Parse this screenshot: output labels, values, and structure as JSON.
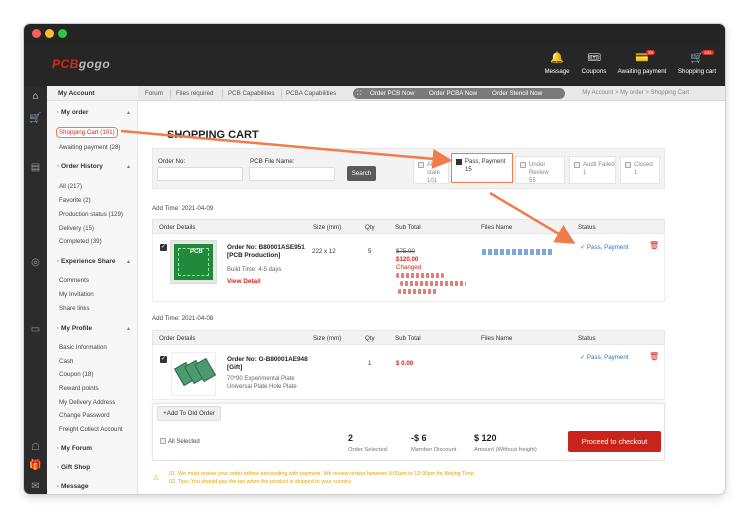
{
  "brand": {
    "logo_text": "PCBgogo"
  },
  "topnav": [
    {
      "label": "Message",
      "icon": "bell-icon"
    },
    {
      "label": "Coupons",
      "icon": "coupon-icon"
    },
    {
      "label": "Awaiting payment",
      "icon": "wallet-icon",
      "badge": "28"
    },
    {
      "label": "Shopping cart",
      "icon": "cart-icon",
      "badge": "101"
    }
  ],
  "sidebar": {
    "header": "My Account",
    "sections": [
      {
        "title": "My order",
        "items": [
          "Shopping Cart (101)",
          "Awaiting payment (28)"
        ]
      },
      {
        "title": "Order History",
        "items": [
          "All (217)",
          "Favorite (2)",
          "Production status (129)",
          "Delivery (15)",
          "Completed (39)"
        ]
      },
      {
        "title": "Experience Share",
        "items": [
          "Comments",
          "My Invitation",
          "Share links"
        ]
      },
      {
        "title": "My Profile",
        "items": [
          "Basic Information",
          "Cash",
          "Coupon (18)",
          "Reward points",
          "My Delivery Address",
          "Change Password",
          "Freight Collect Account"
        ]
      },
      {
        "title": "My Forum",
        "items": []
      },
      {
        "title": "Gift Shop",
        "items": []
      },
      {
        "title": "Message",
        "items": []
      }
    ]
  },
  "crumbbar": {
    "items": [
      "Forum",
      "Files required",
      "PCB Capabilities",
      "PCBA Capabilities"
    ],
    "pill": [
      "Order PCB Now",
      "Order PCBA Now",
      "Order Stencil Now"
    ]
  },
  "breadcrumb": "My Account > My order > Shopping Cart",
  "page_title": "SHOPPING CART",
  "filters": {
    "order_no_label": "Order No:",
    "pcb_file_label": "PCB File Name:",
    "search_label": "Search",
    "statuses": [
      {
        "label": "All state",
        "count": "101",
        "checked": false
      },
      {
        "label": "Pass, Payment",
        "count": "15",
        "checked": true
      },
      {
        "label": "Under Review",
        "count": "55",
        "checked": false
      },
      {
        "label": "Audit Failed",
        "count": "1",
        "checked": false
      },
      {
        "label": "Closed",
        "count": "1",
        "checked": false
      }
    ]
  },
  "table_headers": [
    "Order Details",
    "Size (mm)",
    "Qty",
    "Sub Total",
    "Files Name",
    "Status"
  ],
  "orders": [
    {
      "add_time": "Add Time: 2021-04-09",
      "order_no": "Order No: B80001ASE951",
      "type": "[PCB Production]",
      "build_time": "Build Time: 4-5 days",
      "view_detail": "View Detail",
      "image_label": "PCB",
      "size": "222 x 12",
      "qty": "5",
      "old_price": "$75.00",
      "price": "$120.00",
      "changed": "Changed",
      "status": "Pass, Payment"
    },
    {
      "add_time": "Add Time: 2021-04-08",
      "order_no": "Order No: G-B80001AE948",
      "type": "[Gift]",
      "desc1": "70*90 Experimental Plate",
      "desc2": "Universal Plate Hole Plate",
      "size": "",
      "qty": "1",
      "price": "$ 0.00",
      "status": "Pass, Payment"
    }
  ],
  "bottom": {
    "add_old": "+Add To Old Order",
    "all_selected": "All Selected",
    "order_selected_num": "2",
    "order_selected_lbl": "Order Selected",
    "discount_num": "-$ 6",
    "discount_lbl": "Member Discount",
    "amount_num": "$ 120",
    "amount_lbl": "Amount (Without freight)",
    "checkout": "Proceed to checkout"
  },
  "notes": [
    "01. We must review your order before proceeding with payment. We review orders between 9:00am to 12:00pm for Beijing Time.",
    "02. Tips: You should pay the tax when the product is shipped to your country."
  ],
  "colors": {
    "accent": "#d9261c",
    "highlight": "#f07c4b",
    "status_blue": "#2f72c9",
    "warning": "#e3a400"
  }
}
